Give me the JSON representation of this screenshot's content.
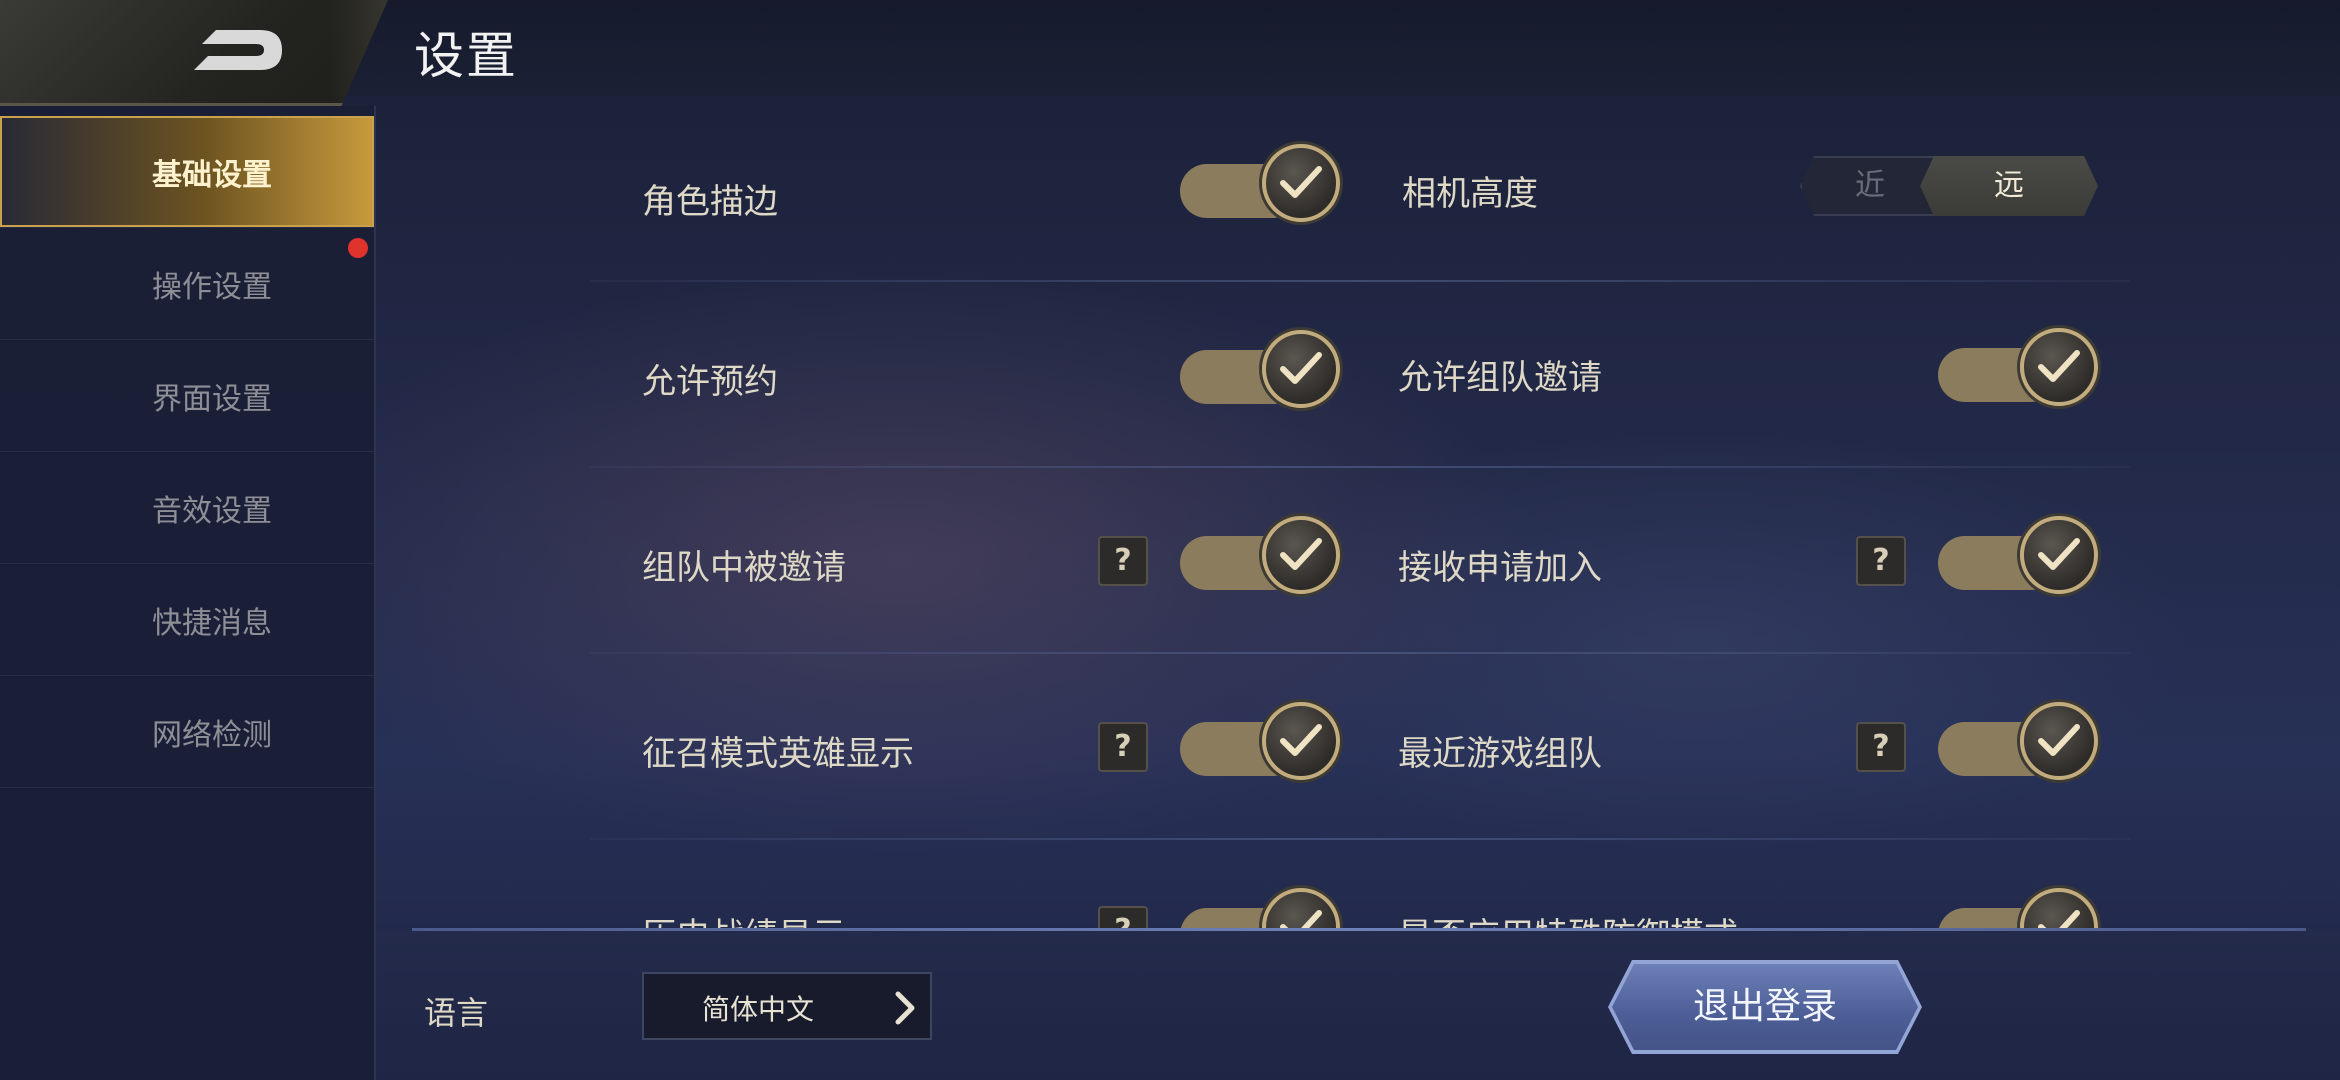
{
  "header": {
    "title": "设置",
    "back_icon": "back-arrow-icon"
  },
  "sidebar": {
    "items": [
      {
        "label": "基础设置",
        "active": true
      },
      {
        "label": "操作设置"
      },
      {
        "label": "界面设置",
        "badge": "red-dot"
      },
      {
        "label": "音效设置"
      },
      {
        "label": "快捷消息"
      },
      {
        "label": "网络检测"
      }
    ]
  },
  "settings": {
    "role_outline": {
      "label": "角色描边",
      "on": true
    },
    "camera_height": {
      "label": "相机高度",
      "options": [
        "近",
        "远"
      ],
      "selected": "远"
    },
    "allow_reservation": {
      "label": "允许预约",
      "on": true
    },
    "allow_team_invite": {
      "label": "允许组队邀请",
      "on": true
    },
    "invited_in_team": {
      "label": "组队中被邀请",
      "help": "?",
      "on": true
    },
    "accept_join_request": {
      "label": "接收申请加入",
      "help": "?",
      "on": true
    },
    "recruit_mode_hero": {
      "label": "征召模式英雄显示",
      "help": "?",
      "on": true
    },
    "recent_game_team": {
      "label": "最近游戏组队",
      "help": "?",
      "on": true
    },
    "history_record": {
      "label": "历史战绩显示",
      "help": "?",
      "on": true
    },
    "special_defense": {
      "label": "是否应用特殊防御模式",
      "on": true
    }
  },
  "footer": {
    "language_label": "语言",
    "language_value": "简体中文",
    "logout_label": "退出登录"
  },
  "colors": {
    "accent_gold": "#c9a14c",
    "toggle_track": "#8a7c5d",
    "logout_blue": "#5b6da6"
  }
}
